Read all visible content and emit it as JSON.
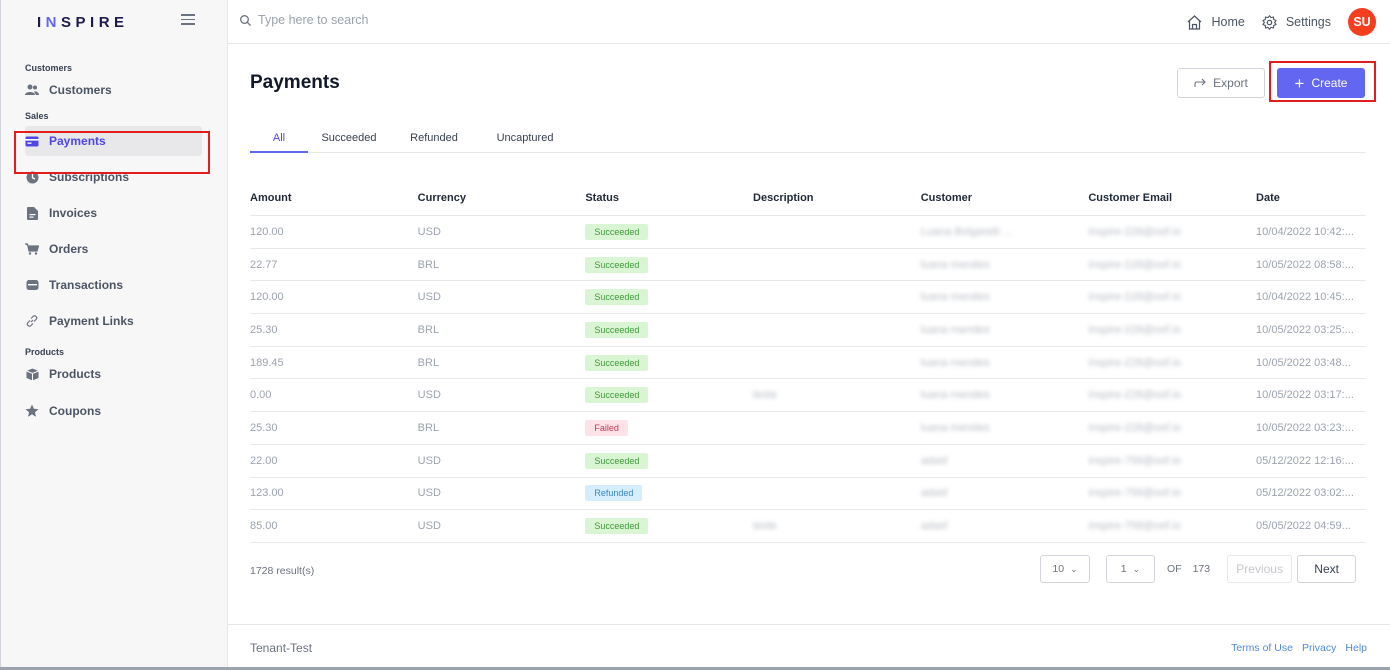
{
  "app": {
    "logo_text": "INSPIRE",
    "accent_color": "#6366f1"
  },
  "sidebar": {
    "sections": [
      {
        "label": "Customers",
        "items": [
          {
            "label": "Customers",
            "icon": "users-icon"
          }
        ]
      },
      {
        "label": "Sales",
        "items": [
          {
            "label": "Payments",
            "icon": "credit-card-icon",
            "active": true
          },
          {
            "label": "Subscriptions",
            "icon": "clock-icon"
          },
          {
            "label": "Invoices",
            "icon": "document-icon"
          },
          {
            "label": "Orders",
            "icon": "cart-icon"
          },
          {
            "label": "Transactions",
            "icon": "wallet-icon"
          },
          {
            "label": "Payment Links",
            "icon": "link-icon"
          }
        ]
      },
      {
        "label": "Products",
        "items": [
          {
            "label": "Products",
            "icon": "box-icon"
          },
          {
            "label": "Coupons",
            "icon": "star-icon"
          }
        ]
      }
    ]
  },
  "topbar": {
    "search_placeholder": "Type here to search",
    "home_label": "Home",
    "settings_label": "Settings",
    "avatar_initials": "SU"
  },
  "page": {
    "title": "Payments",
    "export_label": "Export",
    "create_label": "Create",
    "tabs": [
      "All",
      "Succeeded",
      "Refunded",
      "Uncaptured"
    ],
    "active_tab": "All"
  },
  "table": {
    "columns": [
      "Amount",
      "Currency",
      "Status",
      "Description",
      "Customer",
      "Customer Email",
      "Date"
    ],
    "rows": [
      {
        "amount": "120.00",
        "currency": "USD",
        "status": "Succeeded",
        "description": "",
        "customer": "Luana Bolgarelli ...",
        "email": "inspire-228@oof.io",
        "date": "10/04/2022 10:42:..."
      },
      {
        "amount": "22.77",
        "currency": "BRL",
        "status": "Succeeded",
        "description": "",
        "customer": "luana mendes",
        "email": "inspire-228@oof.io",
        "date": "10/05/2022 08:58:..."
      },
      {
        "amount": "120.00",
        "currency": "USD",
        "status": "Succeeded",
        "description": "",
        "customer": "luana mendes",
        "email": "inspire-228@oof.io",
        "date": "10/04/2022 10:45:..."
      },
      {
        "amount": "25.30",
        "currency": "BRL",
        "status": "Succeeded",
        "description": "",
        "customer": "luana mendes",
        "email": "inspire-228@oof.io",
        "date": "10/05/2022 03:25:..."
      },
      {
        "amount": "189.45",
        "currency": "BRL",
        "status": "Succeeded",
        "description": "",
        "customer": "luana mendes",
        "email": "inspire-228@oof.io",
        "date": "10/05/2022 03:48..."
      },
      {
        "amount": "0.00",
        "currency": "USD",
        "status": "Succeeded",
        "description": "teste",
        "customer": "luana mendes",
        "email": "inspire-228@oof.io",
        "date": "10/05/2022 03:17:..."
      },
      {
        "amount": "25.30",
        "currency": "BRL",
        "status": "Failed",
        "description": "",
        "customer": "luana mendes",
        "email": "inspire-228@oof.io",
        "date": "10/05/2022 03:23:..."
      },
      {
        "amount": "22.00",
        "currency": "USD",
        "status": "Succeeded",
        "description": "",
        "customer": "adasf",
        "email": "inspire-758@oof.io",
        "date": "05/12/2022 12:16:..."
      },
      {
        "amount": "123.00",
        "currency": "USD",
        "status": "Refunded",
        "description": "",
        "customer": "adasf",
        "email": "inspire-758@oof.io",
        "date": "05/12/2022 03:02:..."
      },
      {
        "amount": "85.00",
        "currency": "USD",
        "status": "Succeeded",
        "description": "teste",
        "customer": "adasf",
        "email": "inspire-758@oof.io",
        "date": "05/05/2022 04:59..."
      }
    ]
  },
  "pagination": {
    "results": "1728 result(s)",
    "page_size": "10",
    "current_page": "1",
    "of_label": "OF",
    "total_pages": "173",
    "previous_label": "Previous",
    "next_label": "Next"
  },
  "footer": {
    "tenant": "Tenant-Test",
    "links": [
      "Terms of Use",
      "Privacy",
      "Help"
    ]
  },
  "status_colors": {
    "Succeeded": "#d9f5d3",
    "Failed": "#fde2e8",
    "Refunded": "#d6eefc"
  }
}
